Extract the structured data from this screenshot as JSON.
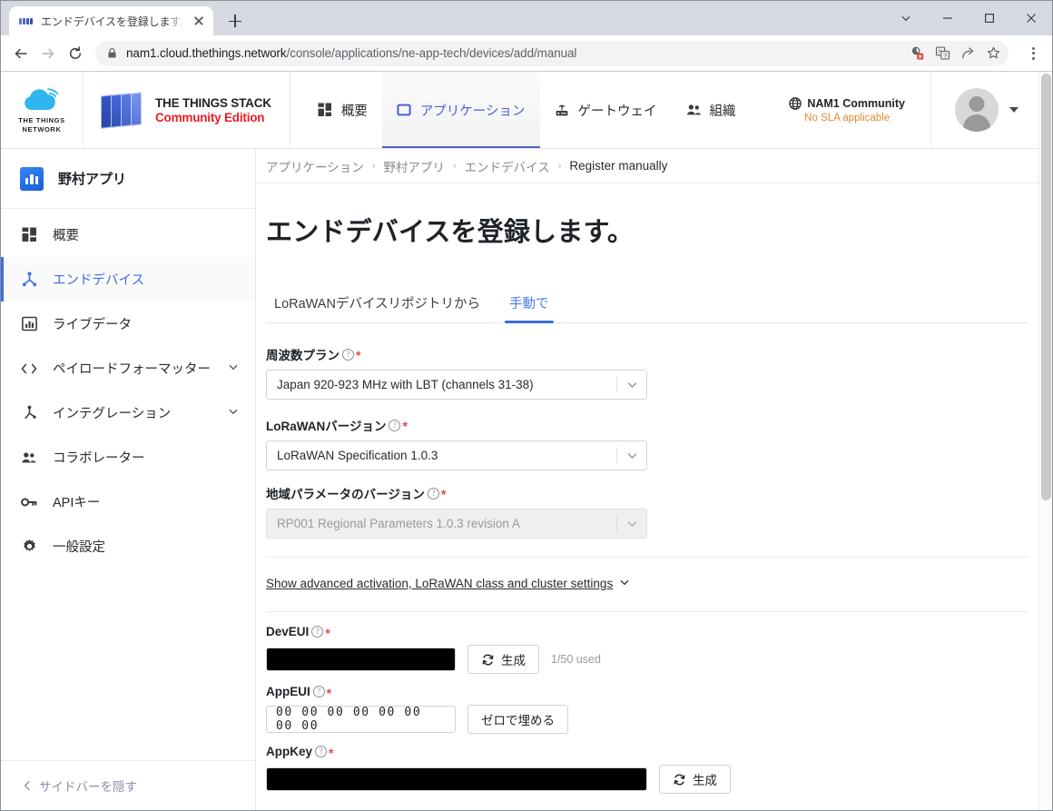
{
  "browser": {
    "tab": {
      "title": "エンドデバイスを登録します。- 野村ア",
      "favicon": "ttn-favicon",
      "close": "close-icon"
    },
    "new_tab_label": "+",
    "window_controls": {
      "minimize": "minimize-icon",
      "maximize": "maximize-icon",
      "close": "close-icon",
      "tab_search": "chevron-down-icon"
    },
    "nav": {
      "back": "back-arrow-icon",
      "forward": "forward-arrow-icon",
      "reload": "reload-icon"
    },
    "omnibox": {
      "lock": "lock-icon",
      "url_host": "nam1.cloud.thethings.network",
      "url_path": "/console/applications/ne-app-tech/devices/add/manual",
      "icons": [
        "cookie-blocked-icon",
        "translate-icon",
        "share-icon",
        "bookmark-star-icon"
      ]
    },
    "menu": "three-dot-menu-icon"
  },
  "topnav": {
    "ttn_logo_line1": "THE THINGS",
    "ttn_logo_line2": "NETWORK",
    "stack_line1": "THE THINGS STACK",
    "stack_line2": "Community Edition",
    "links": [
      {
        "label": "概要",
        "icon": "grid-icon",
        "active": false
      },
      {
        "label": "アプリケーション",
        "icon": "square-icon",
        "active": true
      },
      {
        "label": "ゲートウェイ",
        "icon": "gateway-icon",
        "active": false
      },
      {
        "label": "組織",
        "icon": "people-icon",
        "active": false
      }
    ],
    "cluster_name": "NAM1 Community",
    "cluster_sla": "No SLA applicable",
    "cluster_icon": "globe-icon",
    "avatar": "user-avatar"
  },
  "sidebar": {
    "app_name": "野村アプリ",
    "app_icon": "app-chart-icon",
    "items": [
      {
        "label": "概要",
        "icon": "grid-icon",
        "active": false,
        "chevron": false
      },
      {
        "label": "エンドデバイス",
        "icon": "device-icon",
        "active": true,
        "chevron": false
      },
      {
        "label": "ライブデータ",
        "icon": "chart-icon",
        "active": false,
        "chevron": false
      },
      {
        "label": "ペイロードフォーマッター",
        "icon": "code-icon",
        "active": false,
        "chevron": true
      },
      {
        "label": "インテグレーション",
        "icon": "integration-icon",
        "active": false,
        "chevron": true
      },
      {
        "label": "コラボレーター",
        "icon": "people-icon",
        "active": false,
        "chevron": false
      },
      {
        "label": "APIキー",
        "icon": "key-icon",
        "active": false,
        "chevron": false
      },
      {
        "label": "一般設定",
        "icon": "gear-icon",
        "active": false,
        "chevron": false
      }
    ],
    "hide_label": "サイドバーを隠す",
    "hide_icon": "chevron-left-icon"
  },
  "breadcrumb": {
    "items": [
      "アプリケーション",
      "野村アプリ",
      "エンドデバイス",
      "Register manually"
    ],
    "separator": "›"
  },
  "main": {
    "page_title": "エンドデバイスを登録します。",
    "tabs": [
      {
        "label": "LoRaWANデバイスリポジトリから",
        "active": false
      },
      {
        "label": "手動で",
        "active": true
      }
    ],
    "fields": {
      "freq_plan": {
        "label": "周波数プラン",
        "value": "Japan 920-923 MHz with LBT (channels 31-38)",
        "required": true,
        "disabled": false
      },
      "lorawan_version": {
        "label": "LoRaWANバージョン",
        "value": "LoRaWAN Specification 1.0.3",
        "required": true,
        "disabled": false
      },
      "regional_params": {
        "label": "地域パラメータのバージョン",
        "value": "RP001 Regional Parameters 1.0.3 revision A",
        "required": true,
        "disabled": true
      },
      "dev_eui": {
        "label": "DevEUI",
        "required": true,
        "value": "",
        "redacted": true,
        "button": "生成",
        "button_icon": "refresh-icon",
        "hint": "1/50 used"
      },
      "app_eui": {
        "label": "AppEUI",
        "required": true,
        "value": "00 00 00 00 00 00 00 00",
        "redacted": false,
        "button": "ゼロで埋める"
      },
      "app_key": {
        "label": "AppKey",
        "required": true,
        "value": "",
        "redacted": true,
        "button": "生成",
        "button_icon": "refresh-icon"
      }
    },
    "advanced_link": "Show advanced activation, LoRaWAN class and cluster settings",
    "advanced_chevron": "chevron-down-icon"
  },
  "colors": {
    "accent": "#3b6fe0",
    "brand_red": "#ed1c24",
    "required_red": "#e2483f",
    "sla_orange": "#e08b2e"
  }
}
